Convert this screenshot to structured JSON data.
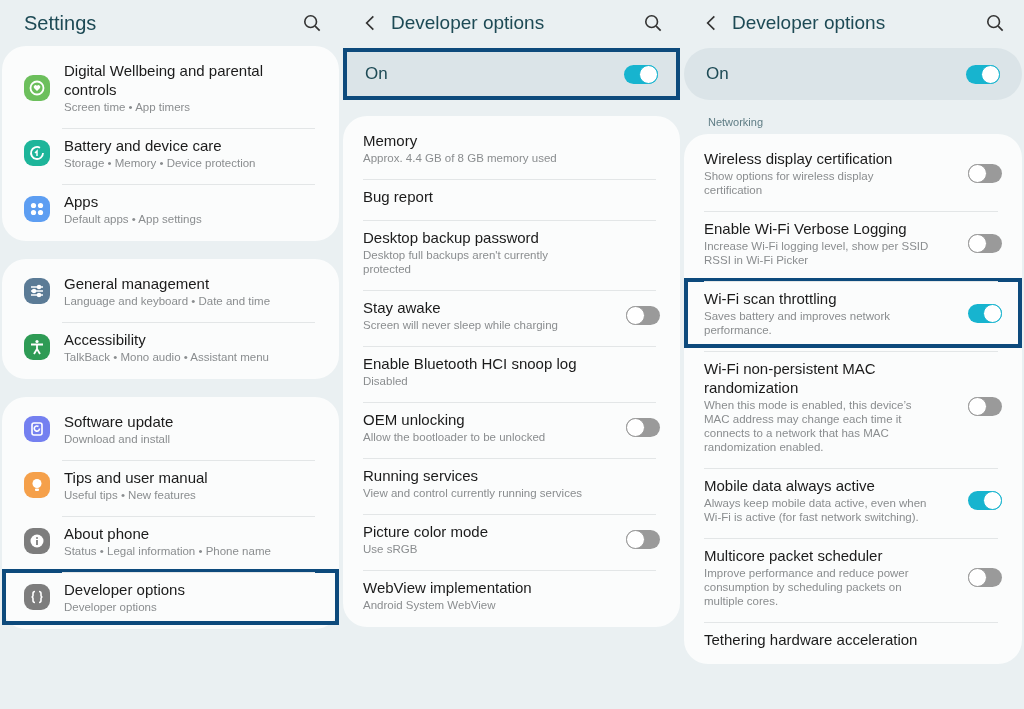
{
  "panels": [
    {
      "kind": "main",
      "title": "Settings",
      "groups": [
        {
          "items": [
            {
              "title": "Digital Wellbeing and parental controls",
              "subtitle": "Screen time  •  App timers",
              "kind": "wellbeing",
              "color": "#6cbf5c",
              "highlighted": false
            },
            {
              "title": "Battery and device care",
              "subtitle": "Storage  •  Memory  •  Device protection",
              "kind": "battery",
              "color": "#1db59a",
              "highlighted": false
            },
            {
              "title": "Apps",
              "subtitle": "Default apps  •  App settings",
              "kind": "apps",
              "color": "#5d9ef2",
              "highlighted": false
            }
          ]
        },
        {
          "items": [
            {
              "title": "General management",
              "subtitle": "Language and keyboard  •  Date and time",
              "kind": "general",
              "color": "#5b7b96",
              "highlighted": false
            },
            {
              "title": "Accessibility",
              "subtitle": "TalkBack  •  Mono audio  •  Assistant menu",
              "kind": "accessibility",
              "color": "#2e9b55",
              "highlighted": false
            }
          ]
        },
        {
          "items": [
            {
              "title": "Software update",
              "subtitle": "Download and install",
              "kind": "update",
              "color": "#7480f0",
              "highlighted": false
            },
            {
              "title": "Tips and user manual",
              "subtitle": "Useful tips  •  New features",
              "kind": "tips",
              "color": "#f5a04a",
              "highlighted": false
            },
            {
              "title": "About phone",
              "subtitle": "Status  •  Legal information  •  Phone name",
              "kind": "about",
              "color": "#7d7d7d",
              "highlighted": false
            },
            {
              "title": "Developer options",
              "subtitle": "Developer options",
              "kind": "developer",
              "color": "#7d7d7d",
              "highlighted": true
            }
          ]
        }
      ]
    },
    {
      "kind": "sub",
      "title": "Developer options",
      "master": {
        "label": "On",
        "on": true,
        "highlighted": true
      },
      "sections": [
        {
          "items": [
            {
              "kind": "text",
              "title": "Memory",
              "subtitle": "Approx. 4.4 GB of 8 GB memory used",
              "highlighted": false
            },
            {
              "kind": "text",
              "title": "Bug report",
              "highlighted": false
            },
            {
              "kind": "text",
              "title": "Desktop backup password",
              "subtitle": "Desktop full backups aren't currently protected",
              "highlighted": false
            },
            {
              "kind": "toggle",
              "title": "Stay awake",
              "subtitle": "Screen will never sleep while charging",
              "on": false,
              "highlighted": false
            },
            {
              "kind": "text",
              "title": "Enable Bluetooth HCI snoop log",
              "subtitle": "Disabled",
              "highlighted": false
            },
            {
              "kind": "toggle",
              "title": "OEM unlocking",
              "subtitle": "Allow the bootloader to be unlocked",
              "on": false,
              "highlighted": false
            },
            {
              "kind": "text",
              "title": "Running services",
              "subtitle": "View and control currently running services",
              "highlighted": false
            },
            {
              "kind": "toggle",
              "title": "Picture color mode",
              "subtitle": "Use sRGB",
              "on": false,
              "highlighted": false
            },
            {
              "kind": "text",
              "title": "WebView implementation",
              "subtitle": "Android System WebView",
              "highlighted": false
            }
          ]
        }
      ]
    },
    {
      "kind": "sub",
      "title": "Developer options",
      "master": {
        "label": "On",
        "on": true,
        "highlighted": false
      },
      "sections": [
        {
          "header": "Networking",
          "items": [
            {
              "kind": "toggle",
              "title": "Wireless display certification",
              "subtitle": "Show options for wireless display certification",
              "on": false,
              "highlighted": false
            },
            {
              "kind": "toggle",
              "title": "Enable Wi-Fi Verbose Logging",
              "subtitle": "Increase Wi-Fi logging level, show per SSID RSSI in Wi-Fi Picker",
              "on": false,
              "highlighted": false
            },
            {
              "kind": "toggle",
              "title": "Wi-Fi scan throttling",
              "subtitle": "Saves battery and improves network performance.",
              "on": true,
              "highlighted": true
            },
            {
              "kind": "toggle",
              "title": "Wi-Fi non-persistent MAC randomization",
              "subtitle": "When this mode is enabled, this device’s MAC address may change each time it connects to a network that has MAC randomization enabled.",
              "on": false,
              "highlighted": false
            },
            {
              "kind": "toggle",
              "title": "Mobile data always active",
              "subtitle": "Always keep mobile data active, even when Wi-Fi is active (for fast network switching).",
              "on": true,
              "highlighted": false
            },
            {
              "kind": "toggle",
              "title": "Multicore packet scheduler",
              "subtitle": "Improve performance and reduce power consumption by scheduling packets on multiple cores.",
              "on": false,
              "highlighted": false
            },
            {
              "kind": "text",
              "title": "Tethering hardware acceleration",
              "highlighted": false
            }
          ]
        }
      ]
    }
  ]
}
